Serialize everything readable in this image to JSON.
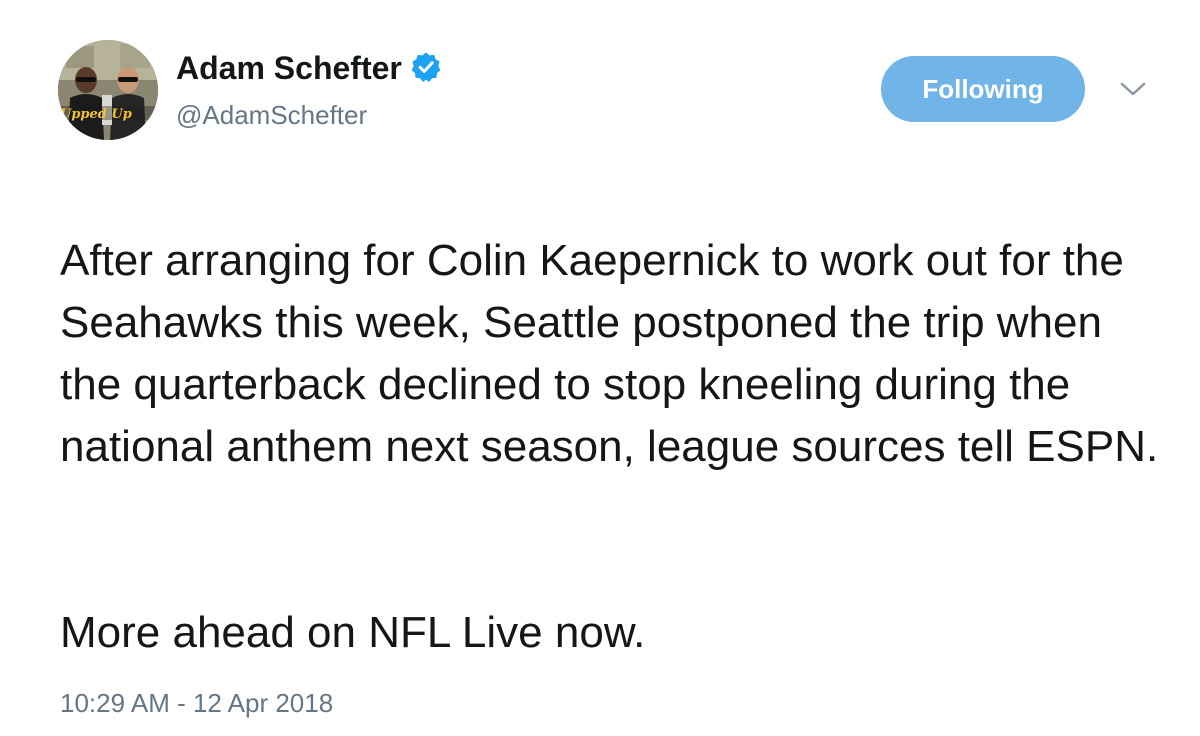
{
  "author": {
    "name": "Adam Schefter",
    "handle": "@AdamSchefter",
    "verified": true,
    "avatar_icon": "profile-photo"
  },
  "follow_button": {
    "label": "Following",
    "color": "#71b4e8"
  },
  "menu_icon": "chevron-down-icon",
  "tweet": {
    "paragraph_1": "After arranging for Colin Kaepernick to work out for the Seahawks this week, Seattle postponed the trip when the quarterback declined to stop kneeling during the national anthem next season, league sources tell ESPN.",
    "paragraph_2": "More ahead on NFL Live now.",
    "timestamp": "10:29 AM - 12 Apr 2018"
  },
  "colors": {
    "verified_badge": "#1da1f2",
    "text_primary": "#14171a",
    "text_secondary": "#657786"
  }
}
